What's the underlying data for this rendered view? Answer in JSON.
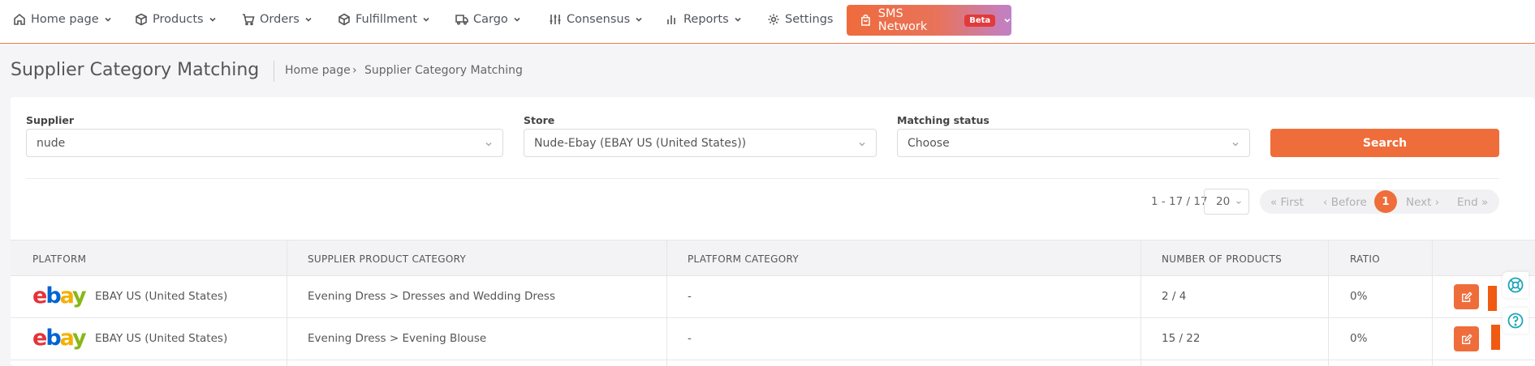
{
  "nav": {
    "items": [
      {
        "label": "Home page"
      },
      {
        "label": "Products"
      },
      {
        "label": "Orders"
      },
      {
        "label": "Fulfillment"
      },
      {
        "label": "Cargo"
      },
      {
        "label": "Consensus"
      },
      {
        "label": "Reports"
      },
      {
        "label": "Settings"
      }
    ],
    "sms_label": "SMS Network",
    "sms_badge": "Beta"
  },
  "header": {
    "title": "Supplier Category Matching",
    "breadcrumb": [
      "Home page",
      "›",
      "Supplier Category Matching"
    ]
  },
  "filters": {
    "supplier_label": "Supplier",
    "supplier_value": "nude",
    "store_label": "Store",
    "store_value": "Nude-Ebay (EBAY US (United States))",
    "status_label": "Matching status",
    "status_value": "Choose",
    "search_label": "Search"
  },
  "pagination": {
    "range": "1 - 17 / 17",
    "page_size": "20",
    "first": "« First",
    "before": "‹ Before",
    "current": "1",
    "next": "Next ›",
    "end": "End »"
  },
  "table": {
    "headers": [
      "PLATFORM",
      "SUPPLIER PRODUCT CATEGORY",
      "PLATFORM CATEGORY",
      "NUMBER OF PRODUCTS",
      "RATIO"
    ],
    "rows": [
      {
        "logo": [
          "e",
          "b",
          "a",
          "y"
        ],
        "platform": "EBAY US (United States)",
        "supplier_category": "Evening Dress > Dresses and Wedding Dress",
        "platform_category": "-",
        "products": "2 / 4",
        "ratio": "0%"
      },
      {
        "logo": [
          "e",
          "b",
          "a",
          "y"
        ],
        "platform": "EBAY US (United States)",
        "supplier_category": "Evening Dress > Evening Blouse",
        "platform_category": "-",
        "products": "15 / 22",
        "ratio": "0%"
      }
    ]
  },
  "colors": {
    "accent": "#ef6d3a",
    "help": "#1aa6b7"
  }
}
